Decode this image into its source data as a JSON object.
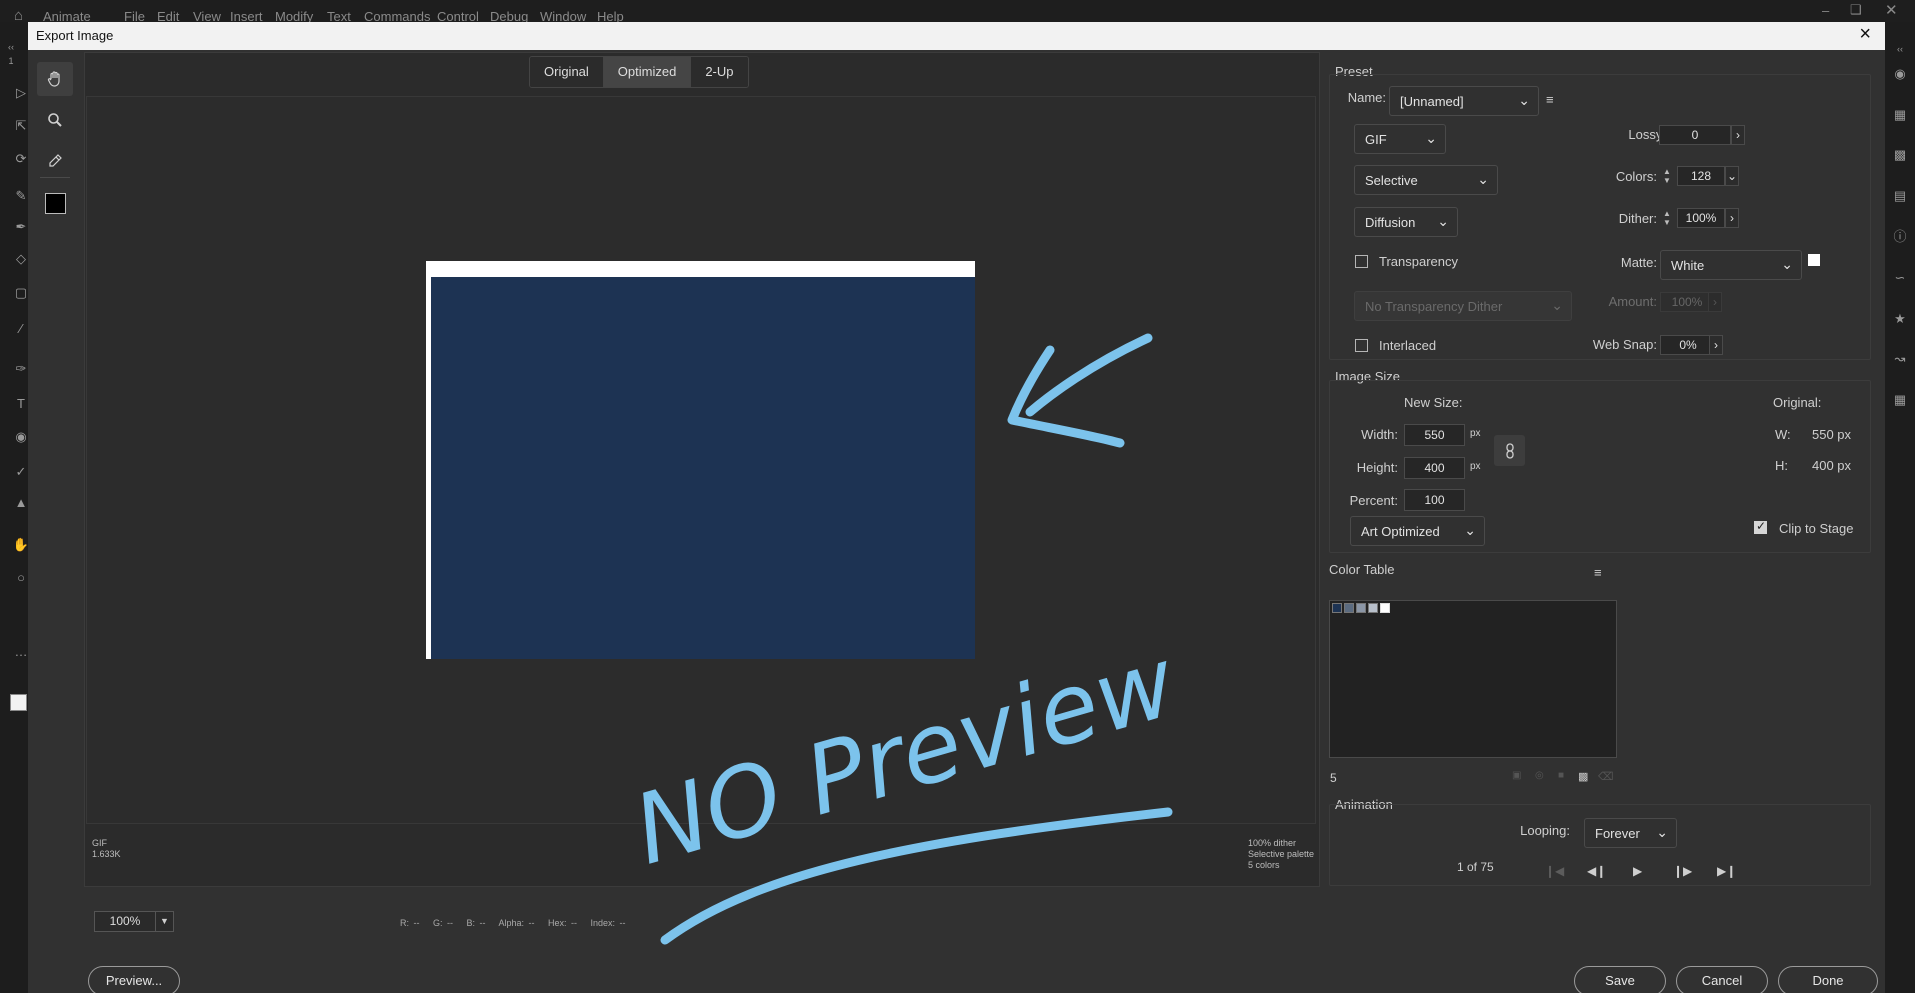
{
  "host": {
    "app_name": "Animate",
    "menu": [
      "File",
      "Edit",
      "View",
      "Insert",
      "Modify",
      "Text",
      "Commands",
      "Control",
      "Debug",
      "Window",
      "Help"
    ],
    "left_panel_number": "1"
  },
  "dialog": {
    "title": "Export Image",
    "close_icon": "close-icon"
  },
  "view_tabs": [
    {
      "label": "Original",
      "active": false
    },
    {
      "label": "Optimized",
      "active": true
    },
    {
      "label": "2-Up",
      "active": false
    }
  ],
  "tools": [
    "hand-icon",
    "zoom-icon",
    "eyedropper-icon",
    "color-swatch"
  ],
  "preview": {
    "format": "GIF",
    "size": "1.633K",
    "info": [
      "100% dither",
      "Selective palette",
      "5 colors"
    ],
    "zoom": "100%",
    "readout": "R: --   G: --   B: --   Alpha: --   Hex: --   Index: --"
  },
  "annotation": {
    "text": "NO Preview",
    "color": "#7cc3ec"
  },
  "preset": {
    "title": "Preset",
    "name_label": "Name:",
    "name_value": "[Unnamed]",
    "format": "GIF",
    "palette": "Selective",
    "dither_algorithm": "Diffusion",
    "transparency_label": "Transparency",
    "transparency_checked": false,
    "transparency_dither": "No Transparency Dither",
    "interlaced_label": "Interlaced",
    "interlaced_checked": false,
    "lossy_label": "Lossy:",
    "lossy_value": "0",
    "colors_label": "Colors:",
    "colors_value": "128",
    "dither_label": "Dither:",
    "dither_value": "100%",
    "matte_label": "Matte:",
    "matte_value": "White",
    "amount_label": "Amount:",
    "amount_value": "100%",
    "websnap_label": "Web Snap:",
    "websnap_value": "0%"
  },
  "image_size": {
    "title": "Image Size",
    "new_size_label": "New Size:",
    "width_label": "Width:",
    "width_value": "550",
    "height_label": "Height:",
    "height_value": "400",
    "percent_label": "Percent:",
    "percent_value": "100",
    "unit": "px",
    "quality": "Art Optimized",
    "original_label": "Original:",
    "orig_w_label": "W:",
    "orig_w_value": "550 px",
    "orig_h_label": "H:",
    "orig_h_value": "400 px",
    "clip_label": "Clip to Stage",
    "clip_checked": true
  },
  "color_table": {
    "title": "Color Table",
    "count": "5",
    "swatches": [
      "#1d3353",
      "#5b6b80",
      "#8b96a6",
      "#b8c0cb",
      "#ffffff"
    ]
  },
  "animation": {
    "title": "Animation",
    "looping_label": "Looping:",
    "looping_value": "Forever",
    "frame_text": "1 of 75"
  },
  "buttons": {
    "preview": "Preview...",
    "save": "Save",
    "cancel": "Cancel",
    "done": "Done"
  },
  "colors": {
    "stage_fill": "#1d3353",
    "stage_bg": "#ffffff",
    "dialog_bg": "#313131"
  }
}
